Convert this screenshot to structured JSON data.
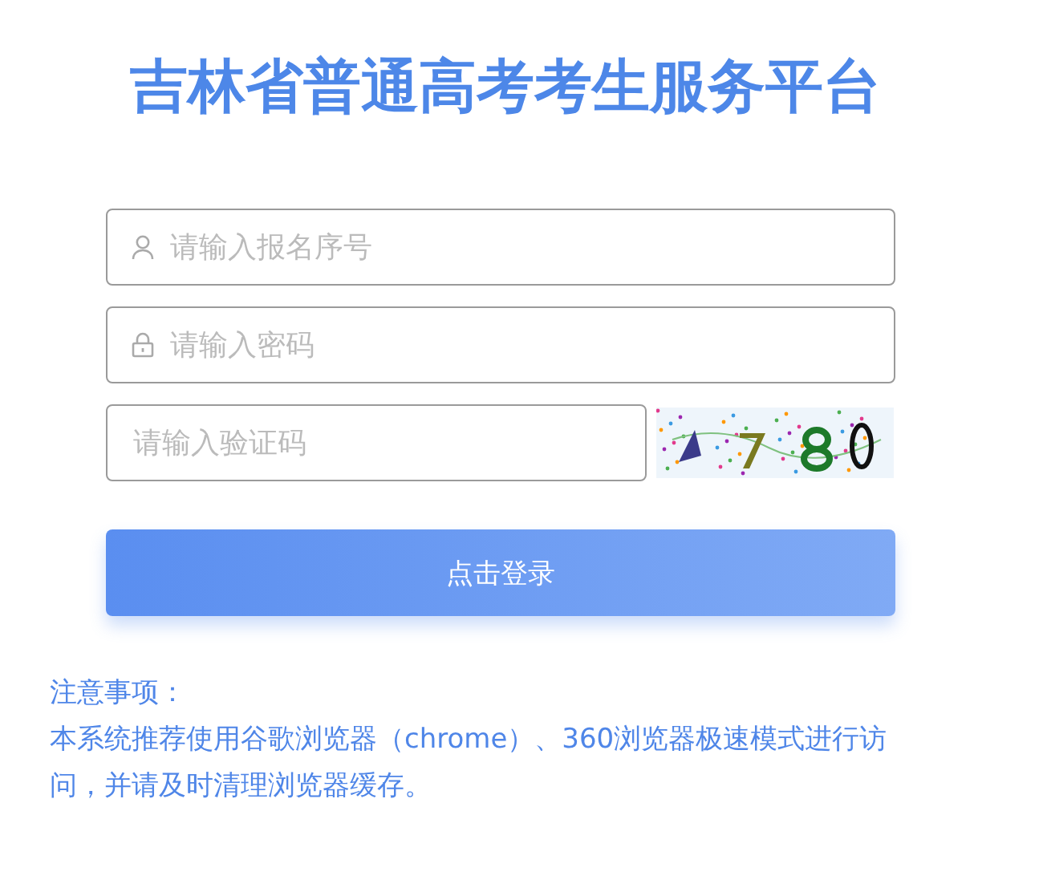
{
  "title": "吉林省普通高考考生服务平台",
  "fields": [
    {
      "placeholder": "请输入报名序号",
      "kind": "person"
    },
    {
      "placeholder": "请输入密码",
      "kind": "lock"
    }
  ],
  "captcha": {
    "placeholder": "请输入验证码",
    "kind": "picture"
  },
  "login_button": "点击登录",
  "notice": {
    "heading": "注意事项：",
    "text": "本系统推荐使用谷歌浏览器（chrome）、360浏览器极速模式进行访问，并请及时清理浏览器缓存。"
  }
}
